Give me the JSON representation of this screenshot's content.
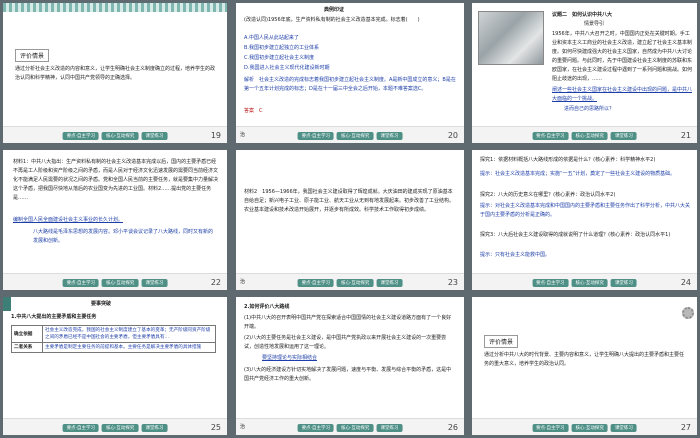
{
  "nav": {
    "prev_label": "要点·自主学习",
    "mid_label": "核心·互动探究",
    "next_label": "课堂练习"
  },
  "slides": {
    "s19": {
      "num": "19",
      "heading": "评价情景",
      "body": "通过分析社会主义改造的内容和意义，让学生明确社会主义制度确立的过程，培养学生的政治认同和科学精神，认同中国共产党领导的正确选择。"
    },
    "s20": {
      "num": "20",
      "mark": "治",
      "heading": "典例印证",
      "question": "(改造认同)1956年底，生产资料私有制的社会主义改造基本完成。标志着(　　)",
      "option_a": "A.中国人民从此站起来了",
      "option_b": "B.我国初步建立起独立的工业体系",
      "option_c": "C.我国初步建立起社会主义制度",
      "option_d": "D.我国进入社会主义现代化建设新时期",
      "analysis": "解析　社会主义改造的完成标志着我国初步建立起社会主义制度。A是新中国成立的意义；B是在第一个五年计划完成的标志；D是在十一届三中全会之后开始，本题不难答案选C。",
      "answer": "答案　C"
    },
    "s21": {
      "num": "21",
      "heading": "议题二　如何认识中共八大",
      "sub": "情景导引",
      "body": "1956年，中共八大召开之时，中国国内正处在关键时期。手工业和资本主义工商业的社会主义改造，建立起了社会主义基本制度。如何尽快建成强大的社会主义国家，自然成为中共八大讨论的重要问题。与此同时，先于中国建设社会主义制度的苏联和东欧国家，在社会主义建设过程中遇到了一系列问题和挑战。如何阻止歧途的出现，……",
      "link": "阐述一些社会主义国家在社会主义建设中出现的问题，是中共八大面临的一个挑战。",
      "extra": "进而自己的思路所以？"
    },
    "s22": {
      "num": "22",
      "body": "材料1：中共八大指出：生产资料私有制的社会主义改造基本完成以后，国内的主要矛盾已经不再是工人阶级和资产阶级之间的矛盾，而是人民对于经济文化迅速发展的需要同当前经济文化不能满足人民需要的状况之间的矛盾。党和全国人民当前的主要任务，就是要集中力量解决这个矛盾，把我国尽快地从落后的农业国变为先进的工业国。材料2……提出党的主要任务是……",
      "link": "编制全国人民全面建设社会主义事业的长久计划。",
      "quote": "八大路线是毛泽东思想的发展内容。邓小平谈会议记录了八大路线，同时又有新的发展和创新。"
    },
    "s23": {
      "num": "23",
      "mark": "治",
      "body": "材料2　1956—1966年，我国社会主义建设取得了辉煌成就。大庆油田的建成实现了原油基本自给自足；新兴电子工业、原子能工业、航天工业从无到有地发展起来。初步改善了工业结构。农业基本建设和技术改造开始展开，并逐步有所成效。科学技术工作取得初步成绩。"
    },
    "s24": {
      "num": "24",
      "q1": "探究1：依据材料概括八大路线形成的依据是什么？(核心素养：科学精神水平2)",
      "a1": "提示：社会主义改造基本完成；实施“一五”计划，奠定了一些社会主义建设的物质基础。",
      "q2": "探究2：八大的历史意义在哪里？(核心素养：政治认同水平2)",
      "a2": "提示：对社会主义改造基本完成和中国国内的主要矛盾和主要任务作出了科学分析，中共八大关于国内主要矛盾的分析是正确的。",
      "q3": "探究3：八大后社会主义建设取得的成就说明了什么道理？(核心素养：政治认同水平1)",
      "a3": "提示：只有社会主义能救中国。"
    },
    "s25": {
      "num": "25",
      "heading": "要事突破",
      "title": "1.中共八大提出的主要矛盾和主要任务",
      "row1_label": "确立依据",
      "row1_text": "社会主义改造完成，我国的社会主义制度建立了基本的变革；无产阶级同资产阶级之间的矛盾已经不是中国社会的主要矛盾，但主要矛盾具有…",
      "row2_label": "二者关系",
      "row2_text": "主要矛盾是制定主要任务的前提和基本。主要任务是解决主要矛盾的具体措施"
    },
    "s26": {
      "num": "26",
      "mark": "治",
      "title": "2.如何评价八大路线",
      "p1": "(1)中共八大的召开表明中国共产党在探索适合中国国情的社会主义建设道路方面有了一个良好开端。",
      "p2": "(2)八大的主要任务是社会主义建设，是中国共产党执政以来开展社会主义建设的一次重要尝试，创造性地发展和运用了这一理论。",
      "link": "要坚持理论与实际相结合",
      "p3": "(3)八大的经济建设方针切实地解决了发展问题，速度与平衡、发展与综合平衡的矛盾，这是中国共产党经济工作的重大创新。"
    },
    "s27": {
      "num": "27",
      "heading": "评价情景",
      "body": "通过分析中共八大的时代背景、主要内容和意义，让学生明确八大提出的主要矛盾和主要任务的重大意义，培养学生的政治认同。"
    }
  }
}
